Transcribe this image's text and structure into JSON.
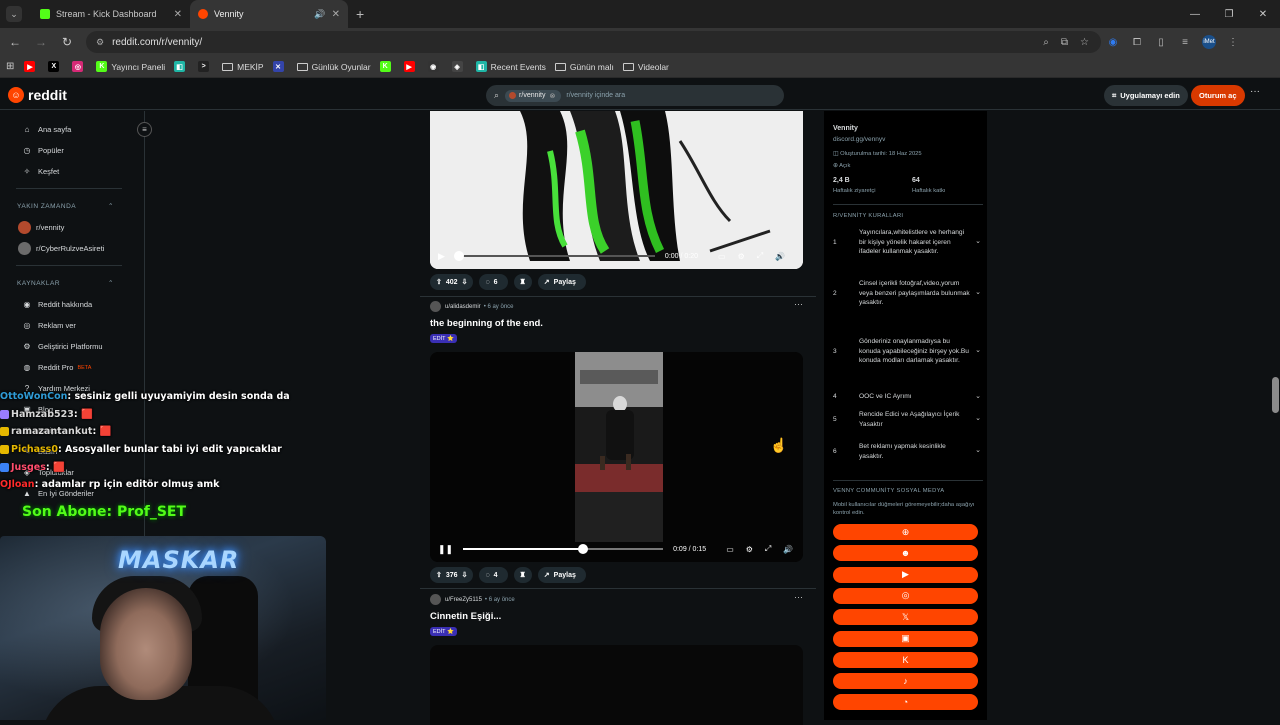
{
  "browser": {
    "tabs": [
      {
        "title": "Stream - Kick Dashboard",
        "fav_color": "#53fc18",
        "active": false
      },
      {
        "title": "Vennity",
        "fav_color": "#ff4500",
        "active": true
      }
    ],
    "url": "reddit.com/r/vennity/",
    "profile_label": "iMet"
  },
  "bookmarks": [
    {
      "label": "",
      "color": "#ff0000",
      "glyph": "▶"
    },
    {
      "label": "",
      "color": "#000000",
      "glyph": "X"
    },
    {
      "label": "",
      "color": "#d62976",
      "glyph": "◎"
    },
    {
      "label": "Yayıncı Paneli",
      "color": "#53fc18",
      "glyph": "K"
    },
    {
      "label": "",
      "color": "#1fb6a6",
      "glyph": "◧"
    },
    {
      "label": "",
      "color": "#222222",
      "glyph": ">"
    },
    {
      "label": "MEKİP",
      "folder": true
    },
    {
      "label": "",
      "color": "#3344aa",
      "glyph": "✕"
    },
    {
      "label": "Günlük Oyunlar",
      "folder": true
    },
    {
      "label": "",
      "color": "#53fc18",
      "glyph": "K"
    },
    {
      "label": "",
      "color": "#ff0000",
      "glyph": "▶"
    },
    {
      "label": "",
      "color": "#333333",
      "glyph": "◉"
    },
    {
      "label": "",
      "color": "#444444",
      "glyph": "◈"
    },
    {
      "label": "Recent Events",
      "color": "#1fb6a6",
      "glyph": "◧"
    },
    {
      "label": "Günün malı",
      "folder": true
    },
    {
      "label": "Videolar",
      "folder": true
    }
  ],
  "reddit": {
    "logo_text": "reddit",
    "search_chip": "r/vennity",
    "search_placeholder": "r/vennity içinde ara",
    "app_button": "Uygulamayı edin",
    "login_button": "Oturum aç"
  },
  "left_nav": {
    "top": [
      {
        "label": "Ana sayfa",
        "icon": "⌂"
      },
      {
        "label": "Popüler",
        "icon": "◷"
      },
      {
        "label": "Keşfet",
        "icon": "✧"
      }
    ],
    "recent_header": "YAKIN ZAMANDA",
    "recent": [
      {
        "label": "r/vennity",
        "color": "#b34a2d"
      },
      {
        "label": "r/CyberRulzveAsireti",
        "color": "#6b6b6b"
      }
    ],
    "resources_header": "KAYNAKLAR",
    "resources": [
      {
        "label": "Reddit hakkında",
        "icon": "◉"
      },
      {
        "label": "Reklam ver",
        "icon": "◎"
      },
      {
        "label": "Geliştirici Platformu",
        "icon": "⚙"
      },
      {
        "label": "Reddit Pro",
        "icon": "◍",
        "badge": "BETA"
      },
      {
        "label": "Yardım Merkezi",
        "icon": "?"
      },
      {
        "label": "Blog",
        "icon": "▣"
      },
      {
        "label": "Kariyer",
        "icon": "▤"
      },
      {
        "label": "Basın",
        "icon": "✎"
      },
      {
        "label": "Topluluklar",
        "icon": "◈"
      },
      {
        "label": "En İyi Gönderiler",
        "icon": "▲"
      }
    ]
  },
  "feed": {
    "post1": {
      "time": "0:00 / 0:20",
      "progress": 0.02,
      "votes": "402",
      "comments": "6",
      "share": "Paylaş"
    },
    "post2": {
      "author": "u/alidasdemir",
      "age": "6 ay önce",
      "title": "the beginning of the end.",
      "flair": "EDİT ⭐",
      "time": "0:09 / 0:15",
      "progress": 0.6,
      "votes": "376",
      "comments": "4",
      "share": "Paylaş"
    },
    "post3": {
      "author": "u/FreeZy5115",
      "age": "6 ay önce",
      "title": "Cinnetin Eşiği...",
      "flair": "EDİT ⭐"
    }
  },
  "community": {
    "name": "Vennity",
    "link": "discord.gg/vennyv",
    "created": "Oluşturulma tarihi: 18 Haz 2025",
    "visibility": "Açık",
    "stats": [
      {
        "value": "2,4 B",
        "label": "Haftalık ziyaretçi"
      },
      {
        "value": "64",
        "label": "Haftalık katkı"
      }
    ],
    "rules_header": "R/VENNİTY KURALLARI",
    "rules": [
      {
        "n": "1",
        "text": "Yayıncılara,whitelistlere ve herhangi bir kişiye yönelik hakaret içeren ifadeler kullanmak yasaktır."
      },
      {
        "n": "2",
        "text": "Cinsel içerikli fotoğraf,video,yorum veya benzeri paylaşımlarda bulunmak yasaktır."
      },
      {
        "n": "3",
        "text": "Gönderiniz onaylanmadıysa bu konuda yapabileceğiniz birşey yok.Bu konuda modları darlamak yasaktır."
      },
      {
        "n": "4",
        "text": "OOC ve IC Ayrımı"
      },
      {
        "n": "5",
        "text": "Rencide Edici ve Aşağılayıcı İçerik Yasaktır"
      },
      {
        "n": "6",
        "text": "Bet reklamı yapmak kesinlikle yasaktır."
      }
    ],
    "social_header": "VENNY COMMUNİTY SOSYAL MEDYA",
    "social_note": "Mobil kullanıcılar düğmeleri göremeyebilir;daha aşağıyı kontrol edin.",
    "social_buttons": [
      {
        "icon": "globe-icon",
        "glyph": "⊕"
      },
      {
        "icon": "discord-icon",
        "glyph": "☻"
      },
      {
        "icon": "youtube-icon",
        "glyph": "▶"
      },
      {
        "icon": "instagram-icon",
        "glyph": "◎"
      },
      {
        "icon": "x-icon",
        "glyph": "𝕏"
      },
      {
        "icon": "twitch-icon",
        "glyph": "▣"
      },
      {
        "icon": "kick-icon",
        "glyph": "K"
      },
      {
        "icon": "tiktok-icon",
        "glyph": "♪"
      },
      {
        "icon": "steam-icon",
        "glyph": "◔"
      }
    ]
  },
  "overlay": {
    "chat": [
      {
        "user": "OttoWonCon",
        "user_color": "#2f9bd6",
        "msg": " : sesiniz gelli uyuyamiyim desin sonda da",
        "badge": ""
      },
      {
        "user": "Hamzab523",
        "user_color": "#d7d7d7",
        "msg": " : 🟥",
        "badge": "#9a7cff"
      },
      {
        "user": "ramazantankut",
        "user_color": "#d7d7d7",
        "msg": " : 🟥",
        "badge": "#e6b800"
      },
      {
        "user": "Pichass0",
        "user_color": "#e6b800",
        "msg": " : Asosyaller bunlar tabi iyi edit yapıcaklar",
        "badge": "#e6b800"
      },
      {
        "user": "Jusges",
        "user_color": "#ff4d6d",
        "msg": " : 🟥",
        "badge": "#3b82f6"
      },
      {
        "user": "OJloan",
        "user_color": "#ff2a2a",
        "msg": " : adamlar rp için editör olmuş amk",
        "badge": ""
      }
    ],
    "last_sub": "Son Abone: Prof_SET",
    "cam_brand": "MASKAR"
  }
}
